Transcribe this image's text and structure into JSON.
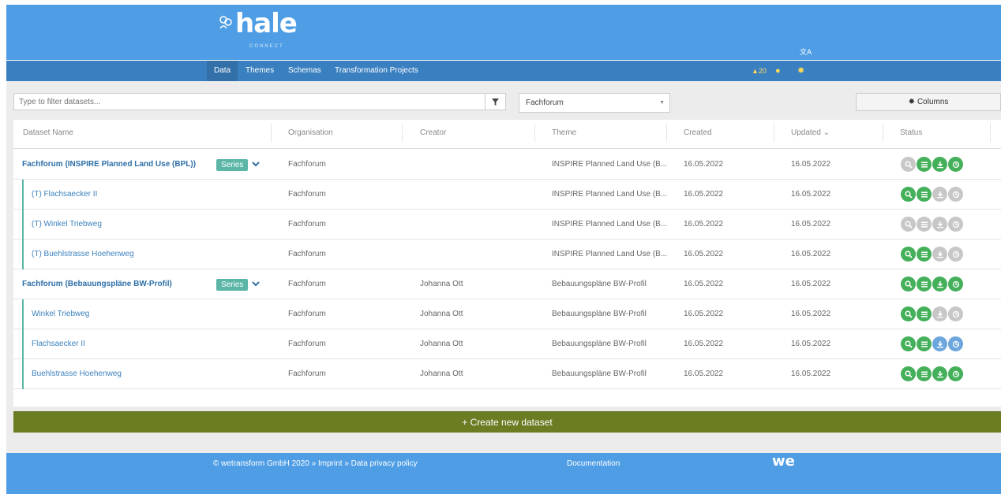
{
  "app": {
    "logo_text": "hale",
    "logo_sub": "CONNECT",
    "brand_color": "#4f9ee5",
    "nav_color": "#3a80c1"
  },
  "nav": {
    "items": [
      {
        "label": "Data",
        "active": true
      },
      {
        "label": "Themes",
        "active": false
      },
      {
        "label": "Schemas",
        "active": false
      },
      {
        "label": "Transformation Projects",
        "active": false
      }
    ],
    "notifications_count": "20",
    "icons": [
      "bell-icon",
      "user-icon",
      "gear-icon",
      "translate-icon"
    ]
  },
  "toolbar": {
    "filter_placeholder": "Type to filter datasets...",
    "filter_value": "",
    "organisation_select": "Fachforum",
    "columns_label": "Columns"
  },
  "table": {
    "headers": [
      "Dataset Name",
      "Organisation",
      "Creator",
      "Theme",
      "Created",
      "Updated",
      "Status"
    ],
    "sort_indicator": "⌄",
    "series_badge": "Series",
    "rows": [
      {
        "name": "Fachforum (INSPIRE Planned Land Use (BPL))",
        "series": true,
        "organisation": "Fachforum",
        "creator": "",
        "theme": "INSPIRE Planned Land Use (B...",
        "created": "16.05.2022",
        "updated": "16.05.2022",
        "status": [
          "grey",
          "green",
          "green",
          "green"
        ]
      },
      {
        "name": "(T) Flachsaecker II",
        "series": false,
        "organisation": "Fachforum",
        "creator": "",
        "theme": "INSPIRE Planned Land Use (B...",
        "created": "16.05.2022",
        "updated": "16.05.2022",
        "status": [
          "green",
          "green",
          "grey",
          "grey"
        ]
      },
      {
        "name": "(T) Winkel Triebweg",
        "series": false,
        "organisation": "Fachforum",
        "creator": "",
        "theme": "INSPIRE Planned Land Use (B...",
        "created": "16.05.2022",
        "updated": "16.05.2022",
        "status": [
          "grey",
          "grey",
          "grey",
          "grey"
        ]
      },
      {
        "name": "(T) Buehlstrasse Hoehenweg",
        "series": false,
        "organisation": "Fachforum",
        "creator": "",
        "theme": "INSPIRE Planned Land Use (B...",
        "created": "16.05.2022",
        "updated": "16.05.2022",
        "status": [
          "green",
          "green",
          "grey",
          "grey"
        ]
      },
      {
        "name": "Fachforum (Bebauungspläne BW-Profil)",
        "series": true,
        "organisation": "Fachforum",
        "creator": "Johanna Ott",
        "theme": "Bebauungspläne BW-Profil",
        "created": "16.05.2022",
        "updated": "16.05.2022",
        "status": [
          "green",
          "green",
          "green",
          "green"
        ]
      },
      {
        "name": "Winkel Triebweg",
        "series": false,
        "organisation": "Fachforum",
        "creator": "Johanna Ott",
        "theme": "Bebauungspläne BW-Profil",
        "created": "16.05.2022",
        "updated": "16.05.2022",
        "status": [
          "green",
          "green",
          "grey",
          "grey"
        ]
      },
      {
        "name": "Flachsaecker II",
        "series": false,
        "organisation": "Fachforum",
        "creator": "Johanna Ott",
        "theme": "Bebauungspläne BW-Profil",
        "created": "16.05.2022",
        "updated": "16.05.2022",
        "status": [
          "green",
          "green",
          "blue",
          "blue"
        ]
      },
      {
        "name": "Buehlstrasse Hoehenweg",
        "series": false,
        "organisation": "Fachforum",
        "creator": "Johanna Ott",
        "theme": "Bebauungspläne BW-Profil",
        "created": "16.05.2022",
        "updated": "16.05.2022",
        "status": [
          "green",
          "green",
          "green",
          "green"
        ]
      }
    ],
    "status_icons": [
      "search-icon",
      "list-icon",
      "download-icon",
      "publish-icon"
    ]
  },
  "create_button": {
    "label": "+ Create new dataset",
    "color": "#6b7d23"
  },
  "footer": {
    "copyright": "© wetransform GmbH 2020 » Imprint » Data privacy policy",
    "documentation": "Documentation",
    "logo": "we"
  }
}
